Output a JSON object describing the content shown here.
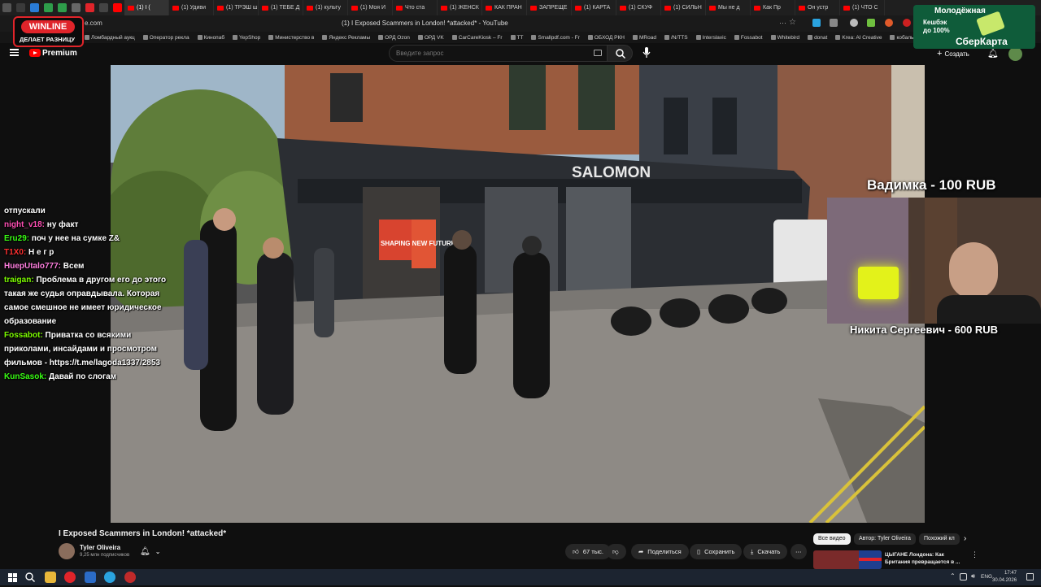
{
  "browser": {
    "tabs": [
      {
        "label": "(1) I (",
        "active": true
      },
      {
        "label": "(1) Удиви",
        "active": false
      },
      {
        "label": "(1) ТРЭШ ш",
        "active": false
      },
      {
        "label": "(1) ТЕБЕ Д",
        "active": false
      },
      {
        "label": "(1) культу",
        "active": false
      },
      {
        "label": "(1) Моя И",
        "active": false
      },
      {
        "label": "Что ста",
        "active": false
      },
      {
        "label": "(1) ЖЕНСК",
        "active": false
      },
      {
        "label": "КАК ПРАН",
        "active": false
      },
      {
        "label": "ЗАПРЕЩЕ",
        "active": false
      },
      {
        "label": "(1) КАРТА",
        "active": false
      },
      {
        "label": "(1) СКУФ",
        "active": false
      },
      {
        "label": "(1) СИЛЬН",
        "active": false
      },
      {
        "label": "Мы не д",
        "active": false
      },
      {
        "label": "Как Пр",
        "active": false
      },
      {
        "label": "Он устр",
        "active": false
      },
      {
        "label": "(1) ЧТО С",
        "active": false
      }
    ],
    "url_fragment": "e.com",
    "page_title": "(1) I Exposed Scammers in London! *attacked* - YouTube",
    "bookmarks": [
      "Ломбардный аукц",
      "Оператор рекла",
      "Кинопаб",
      "YepShop",
      "Министерство в",
      "Яндекс Рекламы",
      "ОРД Ozon",
      "ОРД VK",
      "CarCareKiosk – Fr",
      "TT",
      "Smallpdf.com - Fr",
      "ОБХОД РКН",
      "MRoad",
      "/N/TTS",
      "Interslavic",
      "Fossabot",
      "Whitebird",
      "donat",
      "Krea: AI Creative",
      "кобальт"
    ]
  },
  "youtube": {
    "logo_text": "Premium",
    "search_placeholder": "Введите запрос",
    "create_label": "Создать"
  },
  "video": {
    "sign_text": "SALOMON",
    "shop_window_text": "SHAPING NEW FUTURES"
  },
  "ads": {
    "winline_line1": "WINLINE",
    "winline_line2": "ДЕЛАЕТ РАЗНИЦУ",
    "sber_line1": "Молодёжная",
    "sber_line2": "Кешбэк",
    "sber_line3": "до 100%",
    "sber_line4": "СберКарта"
  },
  "overlay": {
    "donation_top": "Вадимка - 100 RUB",
    "donation_bottom": "Никита Сергеевич - 600 RUB"
  },
  "chat": [
    {
      "name": "",
      "text": "отпускали",
      "color": "#ffffff"
    },
    {
      "name": "night_v18:",
      "text": " ну факт",
      "color": "#ff4fb4"
    },
    {
      "name": "Eru29:",
      "text": " поч у нее на сумке Z&",
      "color": "#39ff14"
    },
    {
      "name": "T1X0:",
      "text": " Н е г р",
      "color": "#ff3030"
    },
    {
      "name": "HuepUtalo777:",
      "text": " Всем",
      "color": "#ff7fdf"
    },
    {
      "name": "traigan:",
      "text": " Проблема в другом его до этого такая же судья оправдывала. Которая самое смешное не имеет юридическое образование",
      "color": "#7cfc00"
    },
    {
      "name": "Fossabot:",
      "text": " Приватка  со всякими приколами, инсайдами и просмотром фильмов - https://t.me/lagoda1337/2853",
      "color": "#7cfc00"
    },
    {
      "name": "KunSasok:",
      "text": " Давай по слогам",
      "color": "#39ff14"
    }
  ],
  "below_video": {
    "title": "I Exposed Scammers in London! *attacked*",
    "channel": "Tyler Oliveira",
    "subscribers": "9,25 млн подписчиков",
    "likes": "67 тыс.",
    "share": "Поделиться",
    "save": "Сохранить",
    "download": "Скачать"
  },
  "filters": [
    "Все видео",
    "Автор: Tyler Oliveira",
    "Похожий кл"
  ],
  "recommendation": {
    "title": "ЦЫГАНЕ Лондона: Как Британия превращается в ..."
  },
  "taskbar": {
    "lang": "ENG",
    "time": "17:47",
    "date": "30.04.2026"
  }
}
